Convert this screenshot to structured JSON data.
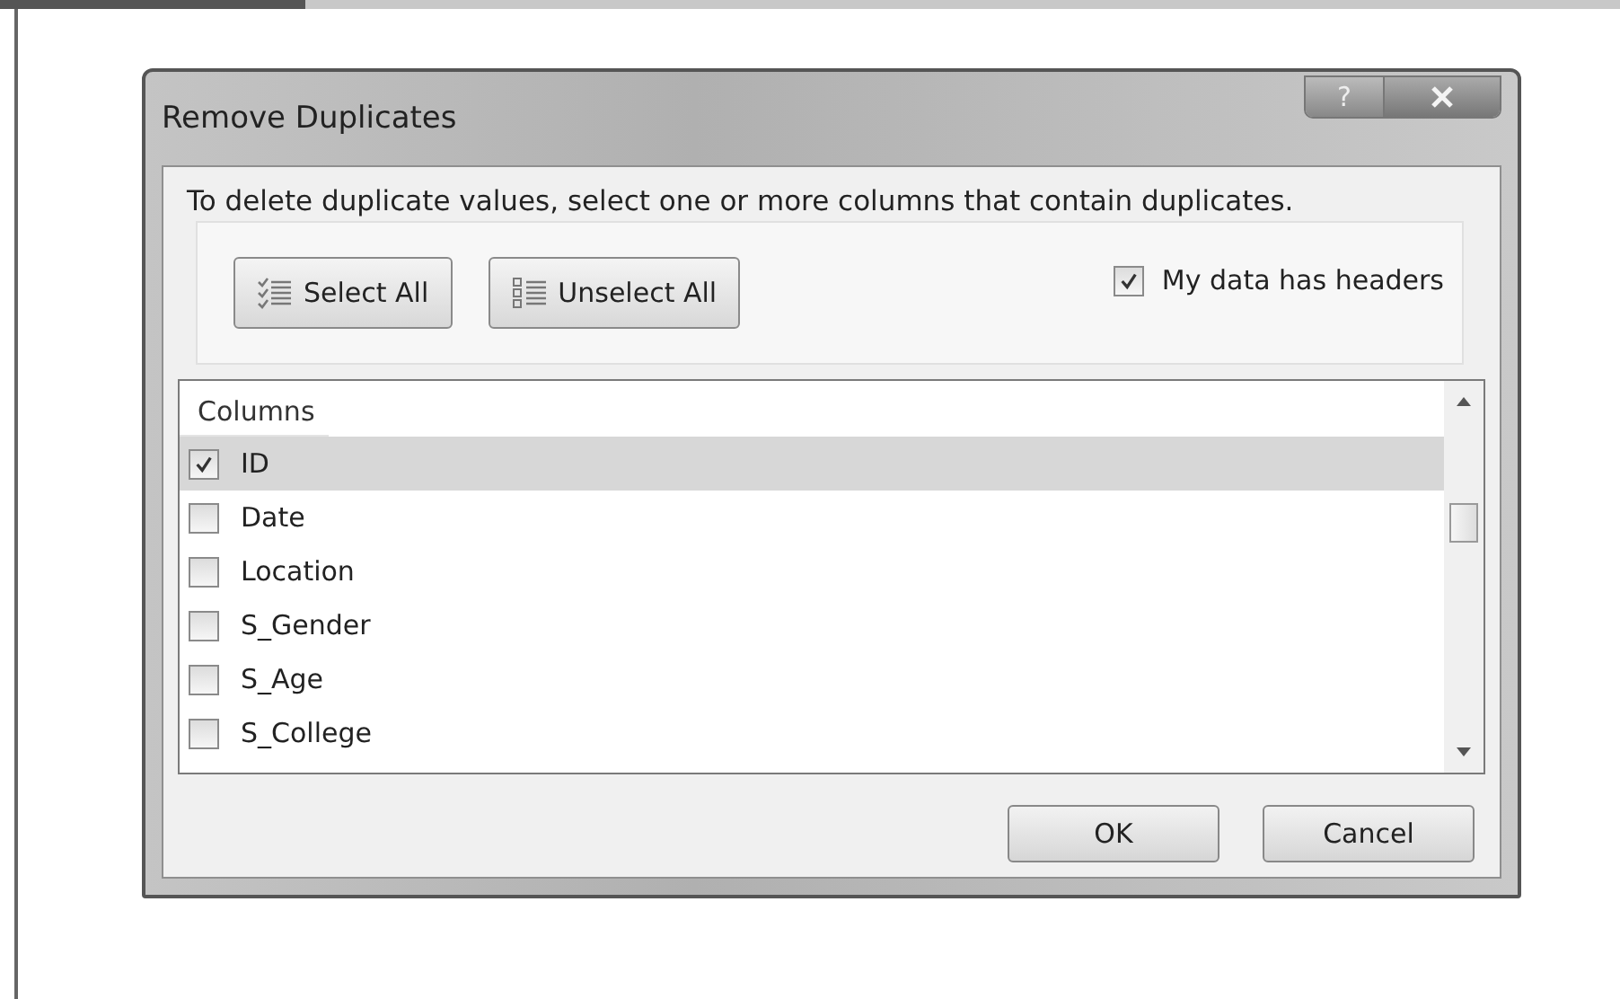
{
  "dialog": {
    "title": "Remove Duplicates",
    "help_label": "?",
    "instruction": "To delete duplicate values, select one or more columns that contain duplicates.",
    "select_all_button": "Select All",
    "unselect_all_button": "Unselect All",
    "headers_checkbox": {
      "label": "My data has headers",
      "checked": true
    },
    "list": {
      "header": "Columns",
      "items": [
        {
          "label": "ID",
          "checked": true,
          "selected": true
        },
        {
          "label": "Date",
          "checked": false,
          "selected": false
        },
        {
          "label": "Location",
          "checked": false,
          "selected": false
        },
        {
          "label": "S_Gender",
          "checked": false,
          "selected": false
        },
        {
          "label": "S_Age",
          "checked": false,
          "selected": false
        },
        {
          "label": "S_College",
          "checked": false,
          "selected": false
        }
      ]
    },
    "buttons": [
      {
        "label": "OK"
      },
      {
        "label": "Cancel"
      }
    ]
  }
}
